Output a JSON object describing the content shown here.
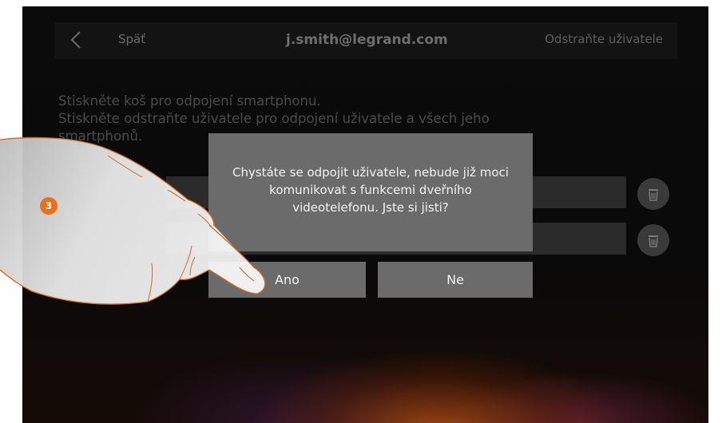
{
  "header": {
    "back_label": "Späť",
    "title": "j.smith@legrand.com",
    "remove_user_label": "Odstraňte uživatele"
  },
  "instructions": {
    "line1": "Stiskněte koš pro odpojení smartphonu.",
    "line2": "Stiskněte odstraňte uživatele pro odpojení uživatele a všech jeho",
    "line3": "smartphonů."
  },
  "dialog": {
    "message": "Chystáte se odpojit uživatele, nebude již moci komunikovat s funkcemi dveřního videotelefonu. Jste si jisti?",
    "yes_label": "Ano",
    "no_label": "Ne"
  },
  "step_badge": "3",
  "icons": {
    "back": "chevron-left-icon",
    "trash": "trash-icon",
    "hand": "pointing-hand-icon"
  },
  "colors": {
    "accent": "#ea6f1f",
    "dialog_bg": "#6b6b6b"
  }
}
